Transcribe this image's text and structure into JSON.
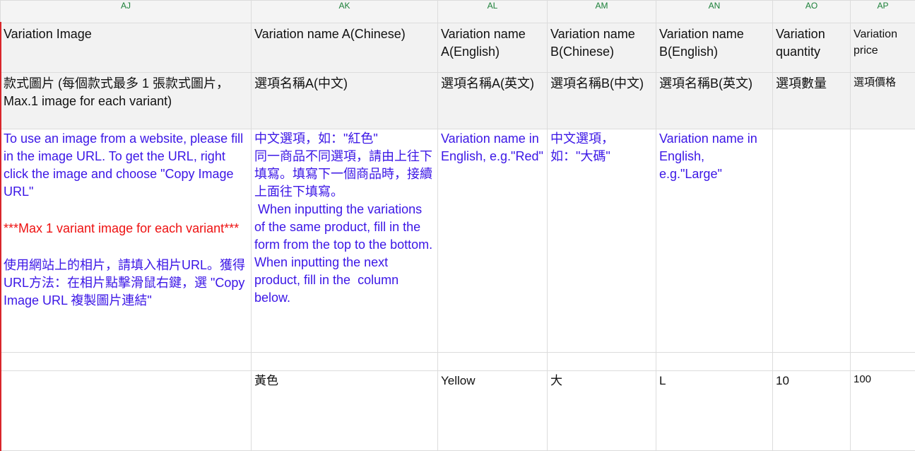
{
  "columns": [
    "AJ",
    "AK",
    "AL",
    "AM",
    "AN",
    "AO",
    "AP"
  ],
  "header_row_1": [
    "Variation Image",
    "Variation name A(Chinese)",
    "Variation name A(English)",
    "Variation name B(Chinese)",
    "Variation name B(English)",
    "Variation quantity",
    "Variation price"
  ],
  "header_row_2": [
    "款式圖片 (每個款式最多 1 張款式圖片， Max.1 image for each variant)",
    "選項名稱A(中文)",
    "選項名稱A(英文)",
    "選項名稱B(中文)",
    "選項名稱B(英文)",
    "選項數量",
    "選項價格"
  ],
  "description_row": {
    "aj": {
      "part1": "To use an image from a website, please fill in the image URL. To get the URL, right click the image and choose \"Copy Image URL\"",
      "part2_red": "***Max 1 variant image for each variant***",
      "part3": "使用網站上的相片，請填入相片URL。獲得URL方法：在相片點擊滑鼠右鍵，選 \"Copy Image URL 複製圖片連結\""
    },
    "ak": "中文選項，如：\"紅色\"\n同一商品不同選項，請由上往下填寫。填寫下一個商品時，接續上面往下填寫。\n When inputting the variations of the same product, fill in the form from the top to the bottom. When inputting the next product, fill in the  column below.",
    "al": "Variation name in English, e.g.\"Red\"",
    "am": "中文選項，如：\"大碼\"",
    "an": "Variation name in English, e.g.\"Large\"",
    "ao": "",
    "ap": ""
  },
  "data_row": [
    "",
    "黃色",
    "Yellow",
    "大",
    "L",
    "10",
    "100"
  ]
}
